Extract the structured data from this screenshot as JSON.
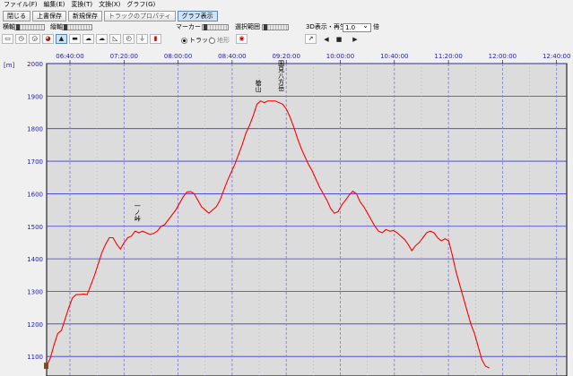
{
  "menu": [
    "ファイル(F)",
    "編集(E)",
    "変換(T)",
    "文換(X)",
    "グラフ(G)"
  ],
  "toolbar": {
    "close": "閉じる",
    "overwrite": "上書保存",
    "save_new": "新規保存",
    "properties": "トラックのプロパティ",
    "graph": "グラフ表示"
  },
  "controls": {
    "h_axis": "横軸",
    "v_axis": "縦軸",
    "marker": "マーカー",
    "selection": "選択範囲",
    "play3d": "3D表示・再生",
    "speed": "1.0",
    "speed_unit": "倍",
    "radio_track": "トラック",
    "radio_terrain": "地形"
  },
  "chart_data": {
    "type": "line",
    "x_ticks": [
      "06:40:00",
      "07:20:00",
      "08:00:00",
      "08:40:00",
      "09:20:00",
      "10:00:00",
      "10:40:00",
      "11:20:00",
      "12:00:00",
      "12:40:00"
    ],
    "y_ticks": [
      1100,
      1200,
      1300,
      1400,
      1500,
      1600,
      1700,
      1800,
      1900,
      2000
    ],
    "ylim": [
      1040,
      2000
    ],
    "xlim": [
      20,
      725
    ],
    "y_unit": "[m]",
    "series": [
      {
        "color": "#ff0000",
        "points": [
          [
            20,
            1070
          ],
          [
            25,
            1095
          ],
          [
            30,
            1135
          ],
          [
            35,
            1170
          ],
          [
            40,
            1180
          ],
          [
            45,
            1215
          ],
          [
            50,
            1250
          ],
          [
            55,
            1280
          ],
          [
            60,
            1290
          ],
          [
            65,
            1290
          ],
          [
            70,
            1292
          ],
          [
            75,
            1290
          ],
          [
            80,
            1320
          ],
          [
            85,
            1350
          ],
          [
            90,
            1385
          ],
          [
            95,
            1420
          ],
          [
            100,
            1445
          ],
          [
            105,
            1465
          ],
          [
            110,
            1465
          ],
          [
            115,
            1445
          ],
          [
            120,
            1430
          ],
          [
            125,
            1450
          ],
          [
            130,
            1465
          ],
          [
            135,
            1470
          ],
          [
            140,
            1485
          ],
          [
            145,
            1480
          ],
          [
            150,
            1485
          ],
          [
            155,
            1480
          ],
          [
            160,
            1475
          ],
          [
            165,
            1478
          ],
          [
            170,
            1485
          ],
          [
            175,
            1500
          ],
          [
            180,
            1505
          ],
          [
            185,
            1520
          ],
          [
            190,
            1535
          ],
          [
            195,
            1550
          ],
          [
            200,
            1570
          ],
          [
            205,
            1590
          ],
          [
            210,
            1605
          ],
          [
            215,
            1607
          ],
          [
            220,
            1600
          ],
          [
            225,
            1580
          ],
          [
            230,
            1560
          ],
          [
            235,
            1550
          ],
          [
            240,
            1540
          ],
          [
            245,
            1550
          ],
          [
            250,
            1560
          ],
          [
            255,
            1580
          ],
          [
            260,
            1610
          ],
          [
            265,
            1640
          ],
          [
            270,
            1665
          ],
          [
            275,
            1690
          ],
          [
            280,
            1720
          ],
          [
            285,
            1750
          ],
          [
            290,
            1785
          ],
          [
            295,
            1810
          ],
          [
            300,
            1840
          ],
          [
            305,
            1875
          ],
          [
            310,
            1885
          ],
          [
            315,
            1880
          ],
          [
            320,
            1885
          ],
          [
            325,
            1885
          ],
          [
            330,
            1885
          ],
          [
            335,
            1880
          ],
          [
            340,
            1875
          ],
          [
            345,
            1860
          ],
          [
            350,
            1835
          ],
          [
            355,
            1805
          ],
          [
            360,
            1770
          ],
          [
            365,
            1740
          ],
          [
            370,
            1715
          ],
          [
            375,
            1690
          ],
          [
            380,
            1670
          ],
          [
            385,
            1645
          ],
          [
            390,
            1620
          ],
          [
            395,
            1600
          ],
          [
            400,
            1580
          ],
          [
            405,
            1555
          ],
          [
            410,
            1540
          ],
          [
            415,
            1545
          ],
          [
            420,
            1565
          ],
          [
            425,
            1580
          ],
          [
            430,
            1595
          ],
          [
            435,
            1608
          ],
          [
            440,
            1600
          ],
          [
            445,
            1575
          ],
          [
            450,
            1560
          ],
          [
            455,
            1540
          ],
          [
            460,
            1520
          ],
          [
            465,
            1500
          ],
          [
            470,
            1485
          ],
          [
            475,
            1480
          ],
          [
            480,
            1490
          ],
          [
            485,
            1485
          ],
          [
            490,
            1487
          ],
          [
            495,
            1480
          ],
          [
            500,
            1470
          ],
          [
            505,
            1460
          ],
          [
            510,
            1445
          ],
          [
            515,
            1425
          ],
          [
            520,
            1440
          ],
          [
            525,
            1450
          ],
          [
            530,
            1465
          ],
          [
            535,
            1480
          ],
          [
            540,
            1485
          ],
          [
            545,
            1480
          ],
          [
            550,
            1465
          ],
          [
            555,
            1455
          ],
          [
            560,
            1462
          ],
          [
            565,
            1455
          ],
          [
            570,
            1410
          ],
          [
            575,
            1360
          ],
          [
            580,
            1320
          ],
          [
            585,
            1280
          ],
          [
            590,
            1240
          ],
          [
            595,
            1200
          ],
          [
            600,
            1170
          ],
          [
            605,
            1130
          ],
          [
            610,
            1090
          ],
          [
            615,
            1070
          ],
          [
            620,
            1065
          ]
        ]
      }
    ],
    "annotations": [
      {
        "text": "一ノ峠",
        "x": 143,
        "y": 1490
      },
      {
        "text": "槍山",
        "x": 307,
        "y": 1890
      },
      {
        "text": "国見八方岳",
        "x": 338,
        "y": 1885
      }
    ]
  }
}
